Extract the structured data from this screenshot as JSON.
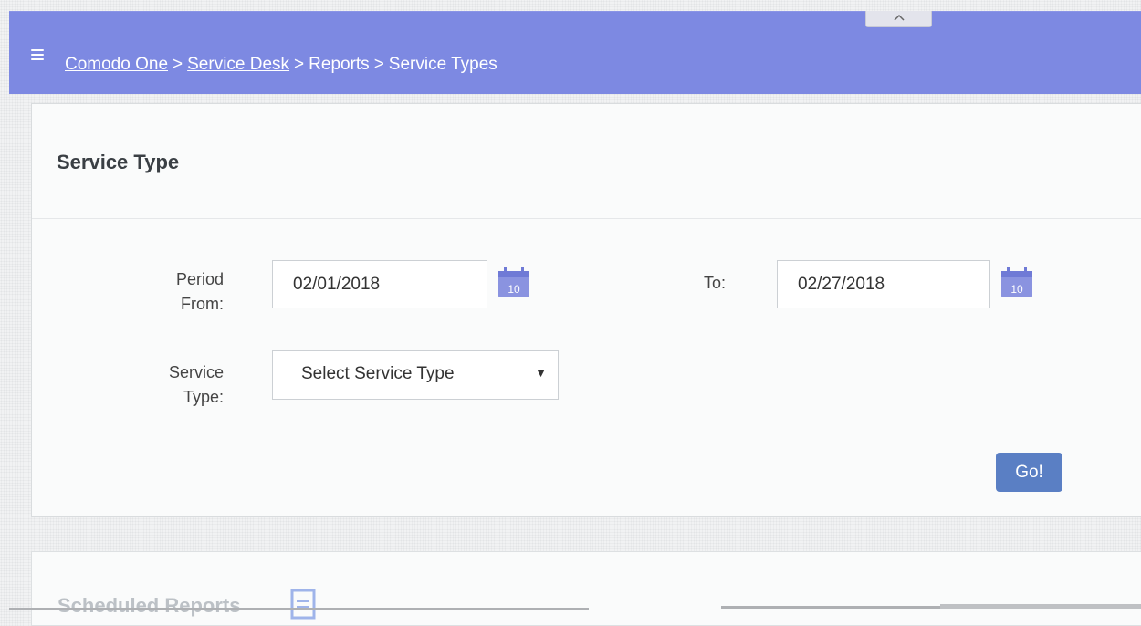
{
  "header": {
    "breadcrumb": [
      {
        "label": "Comodo One",
        "link": true
      },
      {
        "label": "Service Desk",
        "link": true
      },
      {
        "label": "Reports",
        "link": false
      },
      {
        "label": "Service Types",
        "link": false
      }
    ],
    "separator": ">",
    "background": "#7d89e2"
  },
  "card": {
    "title": "Service Type",
    "period_from_label": "Period From:",
    "period_from_value": "02/01/2018",
    "to_label": "To:",
    "to_value": "02/27/2018",
    "calendar_day": "10",
    "service_type_label": "Service Type:",
    "service_type_selected": "Select Service Type",
    "go_label": "Go!",
    "go_color": "#5a7fc4"
  },
  "scheduled": {
    "title": "Scheduled Reports"
  },
  "icons": [
    "menu-icon",
    "collapse-icon",
    "calendar-icon",
    "report-icon"
  ]
}
